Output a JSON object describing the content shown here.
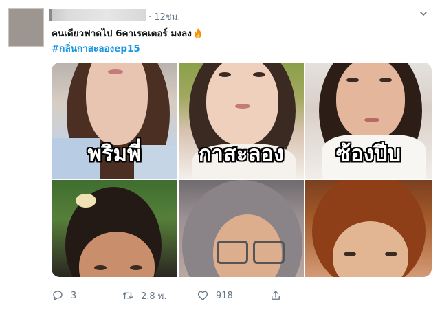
{
  "tweet": {
    "time": "· 12ชม.",
    "text_line1": "คนเดียวฟาดไป 6คาเรคเตอร์ มงลง",
    "hashtag": "#กลิ่นกาสะลองep15",
    "emoji": "fire-emoji"
  },
  "media": {
    "captions": [
      "พริมพี่",
      "กาสะลอง",
      "ซ้องปีบ"
    ]
  },
  "actions": {
    "reply_count": "3",
    "retweet_count": "2.8 พ.",
    "like_count": "918"
  },
  "colors": {
    "hashtag": "#1b95e0",
    "muted": "#657786"
  }
}
